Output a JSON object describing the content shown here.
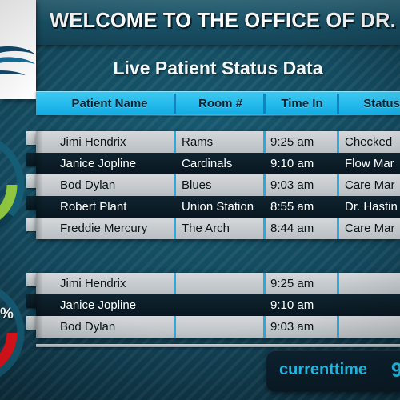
{
  "header": {
    "welcome_title": "WELCOME TO THE OFFICE OF DR.",
    "subtitle": "Live Patient Status Data",
    "logo_icon": "swoosh-logo-icon"
  },
  "colors": {
    "header_band": "#1a5368",
    "accent_cyan": "#25c6f4",
    "column_header_bg": "#27bdee",
    "row_light": "#c6cbce",
    "row_dark": "#0b1c26",
    "gauge_green": "#8ec63f",
    "gauge_red": "#e8141c",
    "gauge_track": "#155c75",
    "background": "#12465a"
  },
  "table": {
    "columns": [
      "Patient Name",
      "Room #",
      "Time In",
      "Status"
    ],
    "primary_rows": [
      {
        "name": "Jimi Hendrix",
        "room": "Rams",
        "time_in": "9:25 am",
        "status": "Checked"
      },
      {
        "name": "Janice Jopline",
        "room": "Cardinals",
        "time_in": "9:10 am",
        "status": "Flow Mar"
      },
      {
        "name": "Bod Dylan",
        "room": "Blues",
        "time_in": "9:03 am",
        "status": "Care Mar"
      },
      {
        "name": "Robert Plant",
        "room": "Union Station",
        "time_in": "8:55 am",
        "status": "Dr. Hastin"
      },
      {
        "name": "Freddie Mercury",
        "room": "The Arch",
        "time_in": "8:44 am",
        "status": "Care Mar"
      }
    ],
    "secondary_rows": [
      {
        "name": "Jimi Hendrix",
        "room": "",
        "time_in": "9:25 am",
        "status": ""
      },
      {
        "name": "Janice Jopline",
        "room": "",
        "time_in": "9:10 am",
        "status": ""
      },
      {
        "name": "Bod Dylan",
        "room": "",
        "time_in": "9:03 am",
        "status": ""
      }
    ]
  },
  "gauges": [
    {
      "name": "green-gauge",
      "color": "#8ec63f",
      "value_label": ""
    },
    {
      "name": "red-gauge",
      "color": "#e8141c",
      "value_label": "%"
    }
  ],
  "footer": {
    "current_time_label": "currenttime",
    "current_time_value": "9"
  }
}
